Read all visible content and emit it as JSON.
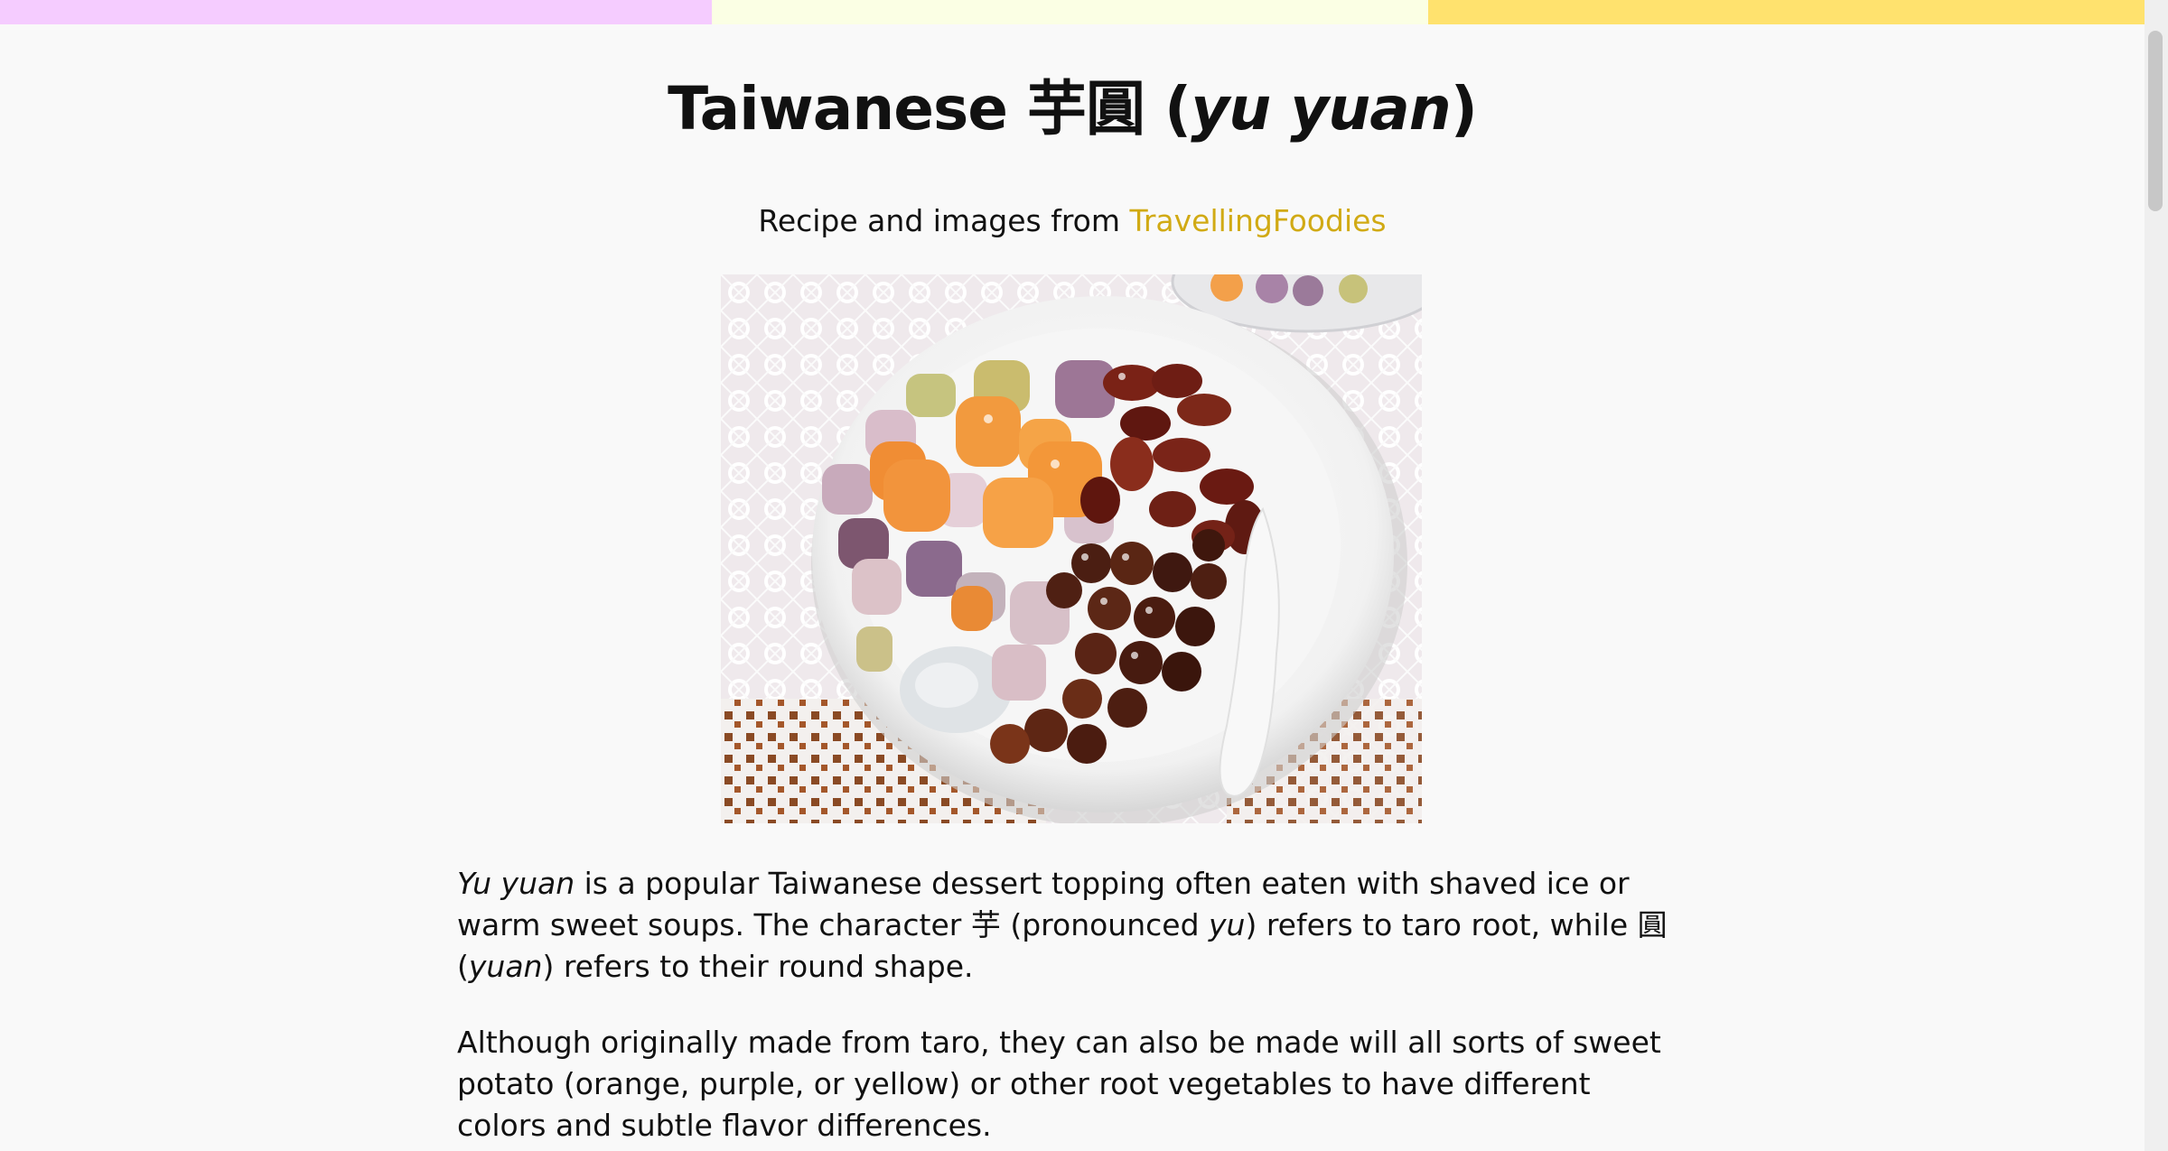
{
  "stripe_colors": [
    "#f5ccff",
    "#fbffe4",
    "#ffe26e"
  ],
  "accent_link_color": "#d1aa14",
  "title": {
    "prefix": "Taiwanese 芋圓 (",
    "italic": "yu yuan",
    "suffix": ")"
  },
  "credit": {
    "text": "Recipe and images from ",
    "link": "TravellingFoodies"
  },
  "image": {
    "description_icon": "photo-of-yu-yuan-bowl"
  },
  "paragraph1": {
    "p1_italic_start": "Yu yuan",
    "p1_text1": " is a popular Taiwanese dessert topping often eaten with shaved ice or warm sweet soups. The character 芋 (pronounced ",
    "p1_italic_yu": "yu",
    "p1_text2": ") refers to taro root, while 圓 (",
    "p1_italic_yuan": "yuan",
    "p1_text3": ") refers to their round shape."
  },
  "paragraph2": {
    "text": "Although originally made from taro, they can also be made will all sorts of sweet potato (orange, purple, or yellow) or other root vegetables to have different colors and subtle flavor differences."
  }
}
